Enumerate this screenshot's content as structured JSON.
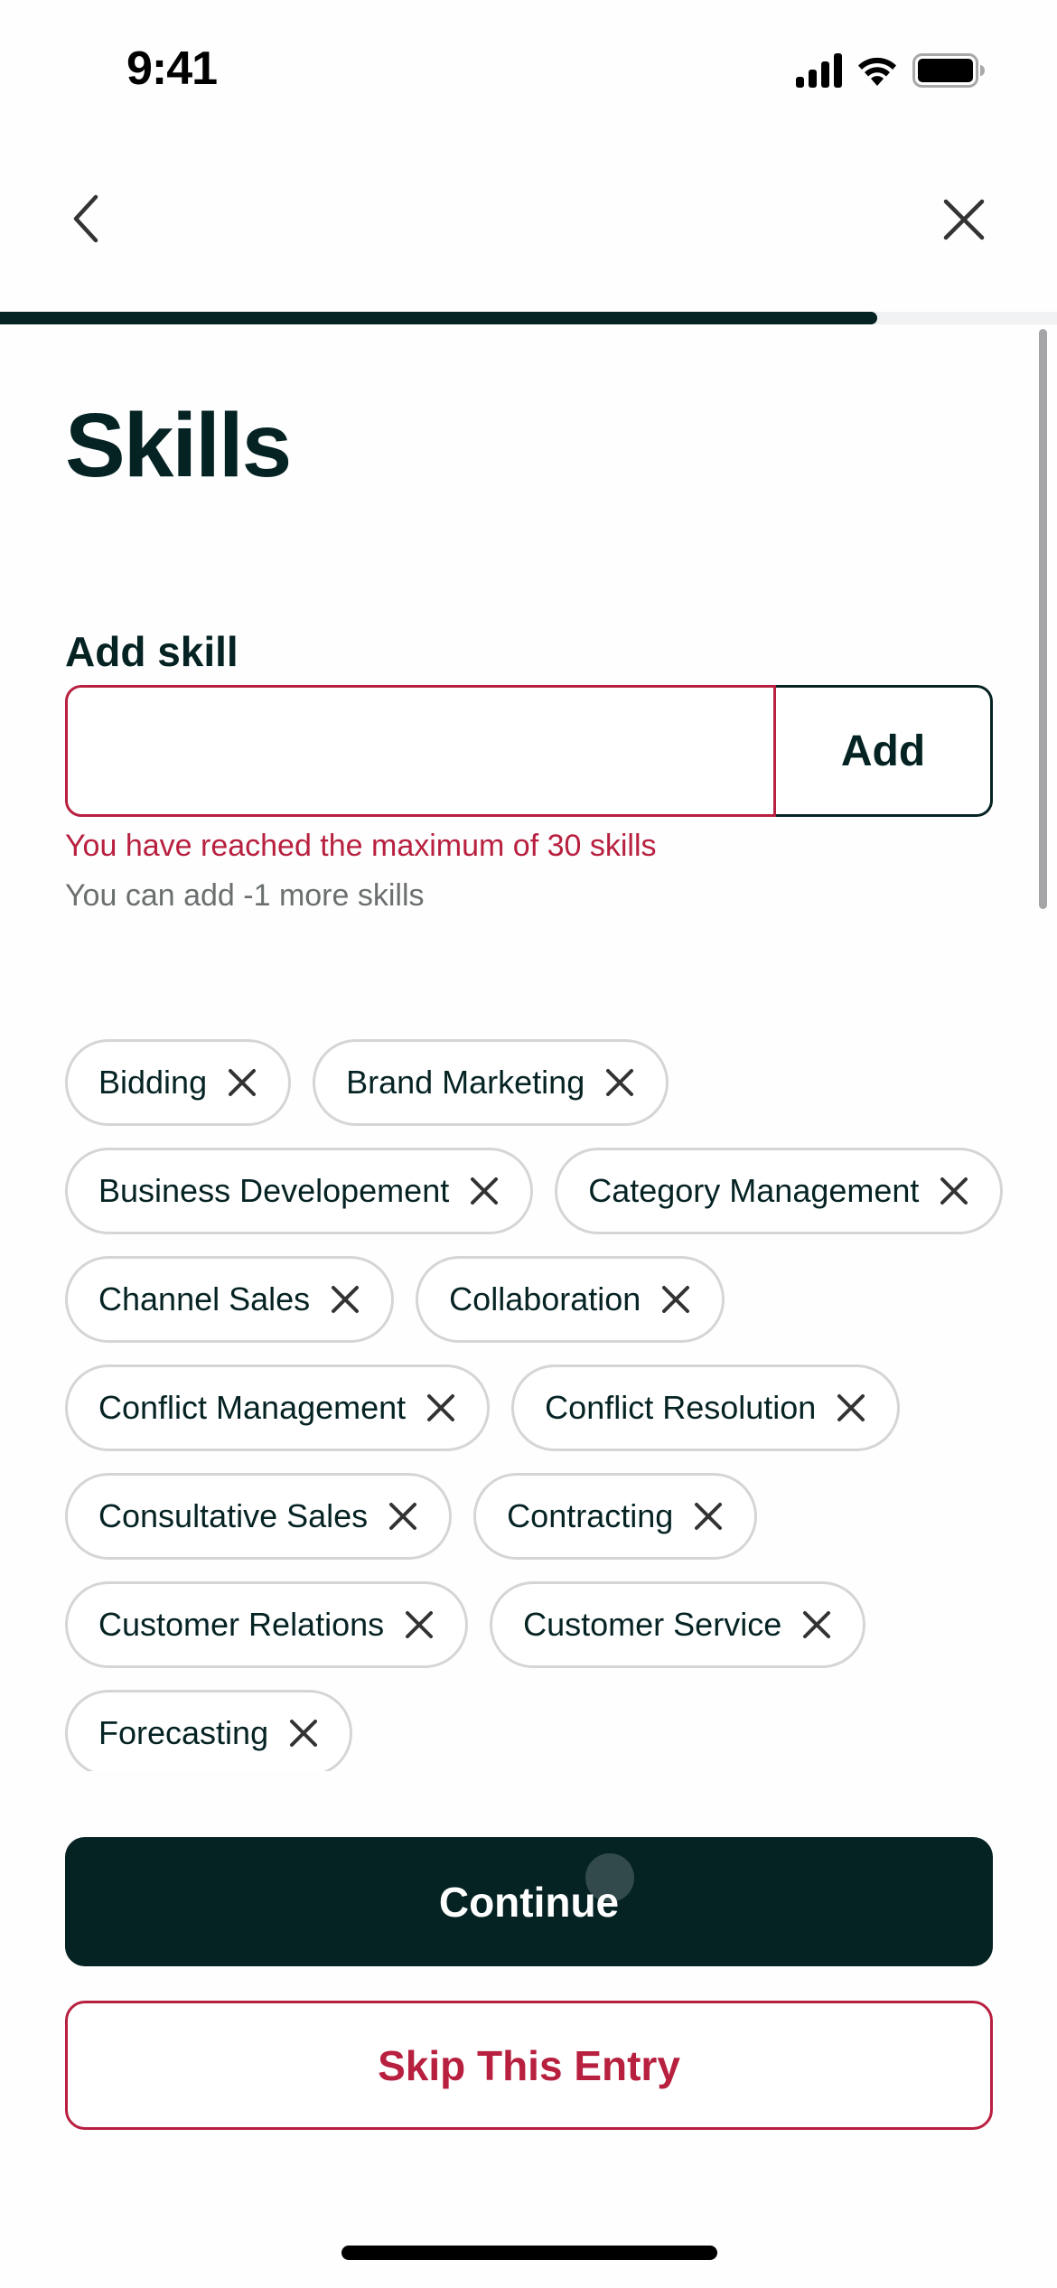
{
  "status_bar": {
    "time": "9:41",
    "icons": [
      "cellular-signal-icon",
      "wifi-icon",
      "battery-icon"
    ]
  },
  "nav": {
    "back_icon": "chevron-left-icon",
    "close_icon": "close-icon"
  },
  "progress": {
    "value": 0.83
  },
  "page": {
    "title": "Skills"
  },
  "add_skill": {
    "label": "Add skill",
    "input_value": "",
    "input_placeholder": "",
    "add_button_label": "Add",
    "error_message": "You have reached the maximum of 30 skills",
    "helper_message": "You can add -1 more skills"
  },
  "skills": [
    "Bidding",
    "Brand Marketing",
    "Business Developement",
    "Category Management",
    "Channel Sales",
    "Collaboration",
    "Conflict Management",
    "Conflict Resolution",
    "Consultative Sales",
    "Contracting",
    "Customer Relations",
    "Customer Service",
    "Forecasting"
  ],
  "actions": {
    "continue_label": "Continue",
    "skip_label": "Skip This Entry"
  },
  "colors": {
    "primary": "#062324",
    "error": "#b8203f",
    "muted_text": "#6b6f70",
    "chip_border": "#d4d5d6"
  }
}
